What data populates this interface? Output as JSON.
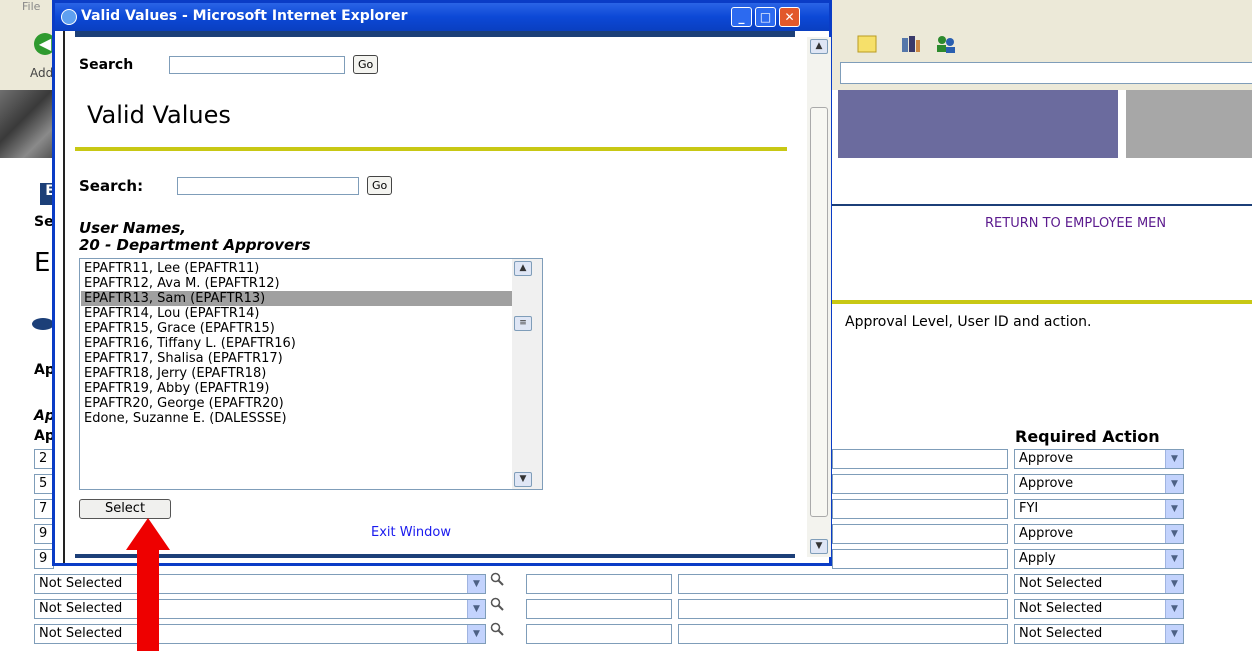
{
  "background": {
    "menu_text": "File",
    "address_label": "Addr",
    "return_link": "RETURN TO EMPLOYEE MEN",
    "instructions": "Approval Level, User ID and action.",
    "required_action_header": "Required Action",
    "peek_letters": [
      "E",
      "Se",
      "E",
      "Ap",
      "Ap",
      "Ap"
    ],
    "rows": [
      {
        "level": "2",
        "action": "Approve"
      },
      {
        "level": "5",
        "action": "Approve"
      },
      {
        "level": "7",
        "action": "FYI"
      },
      {
        "level": "9",
        "action": "Approve"
      },
      {
        "level": "9",
        "action": "Apply"
      },
      {
        "level": "Not Selected",
        "action": "Not Selected"
      },
      {
        "level": "Not Selected",
        "action": "Not Selected"
      },
      {
        "level": "Not Selected",
        "action": "Not Selected"
      }
    ]
  },
  "popup": {
    "window_title": "Valid Values - Microsoft Internet Explorer",
    "top_search_label": "Search",
    "top_go": "Go",
    "page_title": "Valid Values",
    "search_label": "Search:",
    "search_go": "Go",
    "list_heading_line1": "User Names,",
    "list_heading_line2": "20 - Department Approvers",
    "options": [
      "EPAFTR11, Lee (EPAFTR11)",
      "EPAFTR12, Ava M. (EPAFTR12)",
      "EPAFTR13, Sam (EPAFTR13)",
      "EPAFTR14, Lou (EPAFTR14)",
      "EPAFTR15, Grace (EPAFTR15)",
      "EPAFTR16, Tiffany L. (EPAFTR16)",
      "EPAFTR17, Shalisa (EPAFTR17)",
      "EPAFTR18, Jerry (EPAFTR18)",
      "EPAFTR19, Abby (EPAFTR19)",
      "EPAFTR20, George (EPAFTR20)",
      "Edone, Suzanne E. (DALESSSE)"
    ],
    "selected_option": "EPAFTR13, Sam (EPAFTR13)",
    "select_button": "Select",
    "exit_link": "Exit Window",
    "controls": {
      "minimize": "_",
      "maximize": "□",
      "close": "✕"
    }
  },
  "colors": {
    "accent_arrow": "#ee0000",
    "title_bar": "#0c48d6",
    "rule_yellow": "#c8c814",
    "rule_blue": "#1c3f78",
    "link": "#1a1aee"
  },
  "icons": [
    "back-arrow-icon",
    "ie-logo-icon",
    "note-icon",
    "media-icon",
    "contacts-icon",
    "magnifier-icon",
    "dropdown-arrow-icon"
  ]
}
